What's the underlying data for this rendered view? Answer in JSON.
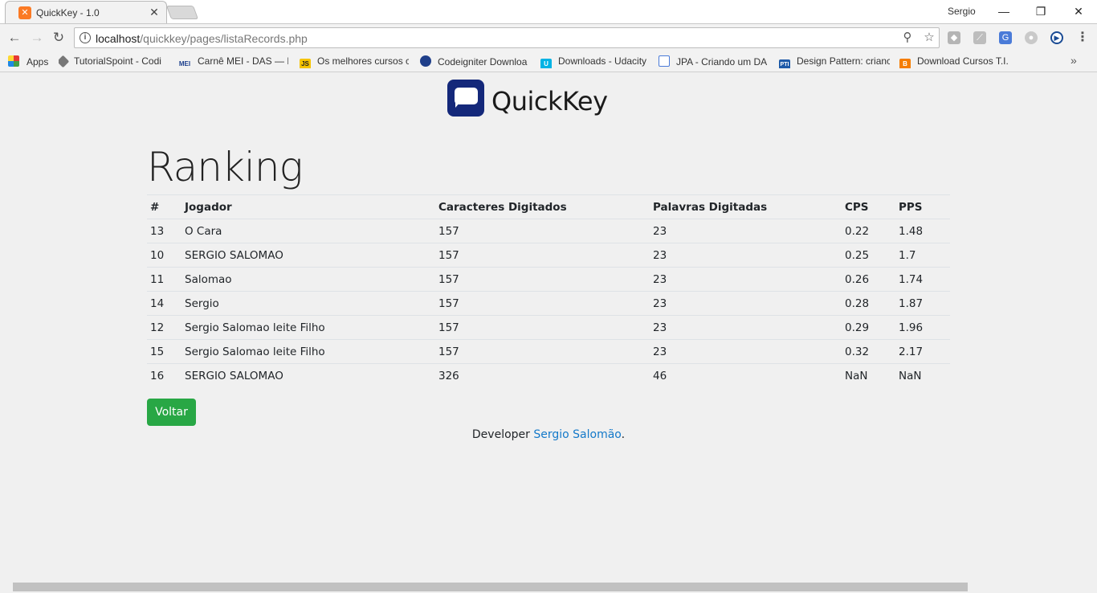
{
  "browser": {
    "tab_title": "QuickKey - 1.0",
    "tab_close": "✕",
    "user": "Sergio",
    "url_host": "localhost",
    "url_path": "/quickkey/pages/listaRecords.php"
  },
  "bookmarks": [
    "Apps",
    "TutorialSpoint - Codi",
    "Carnê MEI - DAS — P",
    "Os melhores cursos c",
    "Codeigniter Downloa",
    "Downloads - Udacity",
    "JPA - Criando um DA",
    "Design Pattern: crianc",
    "Download Cursos T.I."
  ],
  "page": {
    "logo_text": "QuickKey",
    "heading": "Ranking",
    "columns": [
      "#",
      "Jogador",
      "Caracteres Digitados",
      "Palavras Digitadas",
      "CPS",
      "PPS"
    ],
    "rows": [
      [
        "13",
        "O Cara",
        "157",
        "23",
        "0.22",
        "1.48"
      ],
      [
        "10",
        "SERGIO SALOMAO",
        "157",
        "23",
        "0.25",
        "1.7"
      ],
      [
        "11",
        "Salomao",
        "157",
        "23",
        "0.26",
        "1.74"
      ],
      [
        "14",
        "Sergio",
        "157",
        "23",
        "0.28",
        "1.87"
      ],
      [
        "12",
        "Sergio Salomao leite Filho",
        "157",
        "23",
        "0.29",
        "1.96"
      ],
      [
        "15",
        "Sergio Salomao leite Filho",
        "157",
        "23",
        "0.32",
        "2.17"
      ],
      [
        "16",
        "SERGIO SALOMAO",
        "326",
        "46",
        "NaN",
        "NaN"
      ]
    ],
    "back_button": "Voltar",
    "footer_prefix": "Developer ",
    "footer_link": "Sergio Salomão",
    "footer_suffix": "."
  },
  "colors": {
    "button_green": "#28a745",
    "link_blue": "#1479c9",
    "logo_navy": "#14287a",
    "favicon_orange": "#fb7a24"
  }
}
